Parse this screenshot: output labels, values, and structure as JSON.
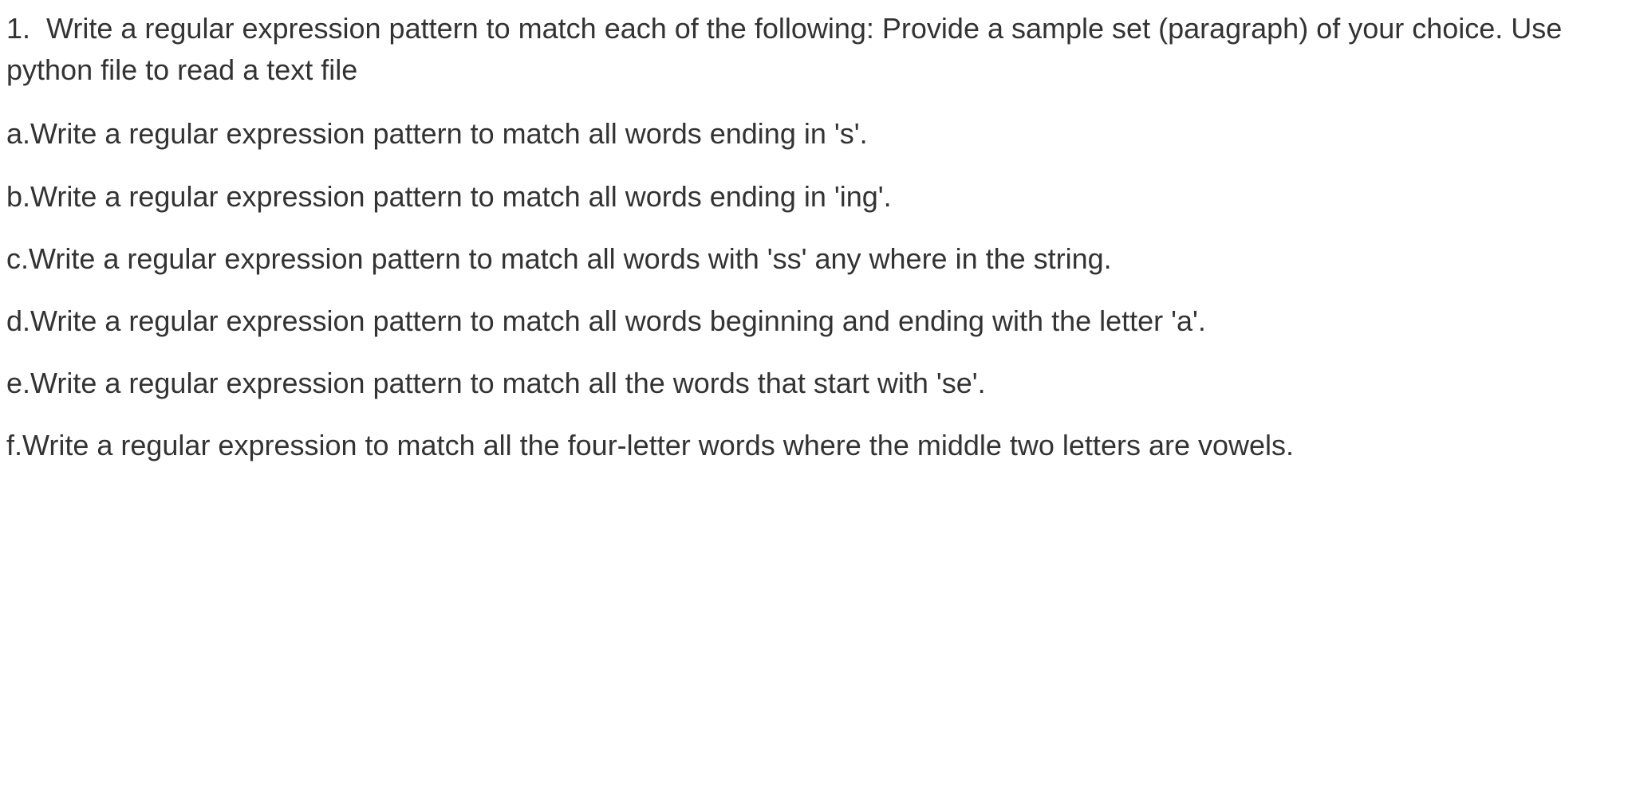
{
  "question": {
    "intro": "1.  Write a regular expression pattern to match each of the following: Provide a sample set (paragraph) of your choice. Use python file to read a text file",
    "parts": [
      "a.Write a regular expression pattern to match all words ending in 's'.",
      "b.Write a regular expression pattern to match all words ending in 'ing'.",
      "c.Write a regular expression pattern to match all words with 'ss' any where in the string.",
      "d.Write a regular expression pattern to match all words beginning and ending with the letter 'a'.",
      "e.Write a regular expression pattern to match all the words that start with 'se'.",
      "f.Write a regular expression to match all the four-letter words where the middle two letters are vowels."
    ]
  }
}
